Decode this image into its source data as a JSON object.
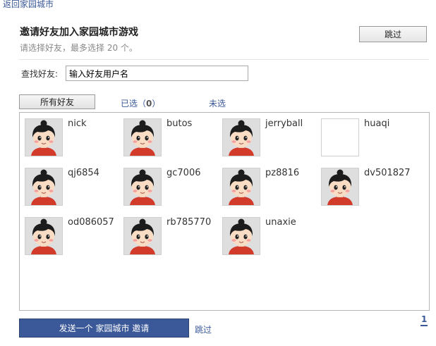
{
  "nav": {
    "back_label": "返回家园城市"
  },
  "header": {
    "title": "邀请好友加入家园城市游戏",
    "subtitle": "请选择好友，最多选择 20 个。",
    "skip_label": "跳过"
  },
  "search": {
    "label": "查找好友:",
    "value": "输入好友用户名"
  },
  "tabs": {
    "all_label": "所有好友",
    "selected_prefix": "已选（",
    "selected_count": "0",
    "selected_suffix": "）",
    "unselected_label": "未选"
  },
  "friends": [
    {
      "name": "nick",
      "avatar": "default-avatar"
    },
    {
      "name": "butos",
      "avatar": "default-avatar"
    },
    {
      "name": "jerryball",
      "avatar": "default-avatar"
    },
    {
      "name": "huaqi",
      "avatar": "empty"
    },
    {
      "name": "qj6854",
      "avatar": "default-avatar"
    },
    {
      "name": "gc7006",
      "avatar": "default-avatar"
    },
    {
      "name": "pz8816",
      "avatar": "default-avatar"
    },
    {
      "name": "dv501827",
      "avatar": "default-avatar"
    },
    {
      "name": "od086057",
      "avatar": "default-avatar"
    },
    {
      "name": "rb785770",
      "avatar": "default-avatar"
    },
    {
      "name": "unaxie",
      "avatar": "default-avatar"
    }
  ],
  "footer": {
    "send_label": "发送一个 家园城市 邀请",
    "skip_label": "跳过",
    "page": "1"
  },
  "colors": {
    "link": "#3b5998",
    "button_primary": "#3b5998",
    "panel_border": "#b5b5b5"
  }
}
